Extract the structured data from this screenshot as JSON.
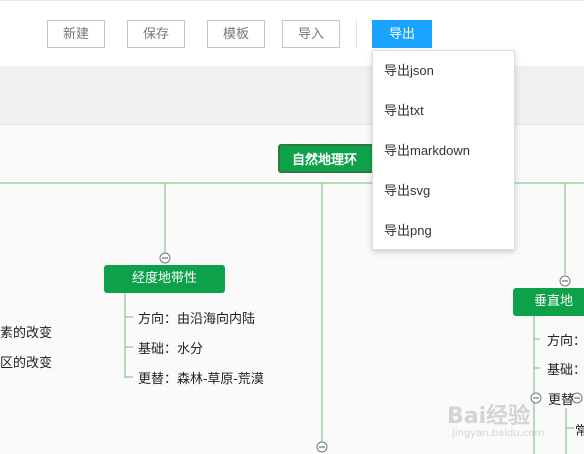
{
  "toolbar": {
    "new": "新建",
    "save": "保存",
    "template": "模板",
    "import": "导入",
    "export": "导出"
  },
  "export_menu": {
    "items": [
      "导出json",
      "导出txt",
      "导出markdown",
      "导出svg",
      "导出png"
    ]
  },
  "mindmap": {
    "root": "自然地理环",
    "left_leaves": [
      "素的改变",
      "区的改变"
    ],
    "branch_longitude": {
      "title": "经度地带性",
      "items": [
        "方向：由沿海向内陆",
        "基础：水分",
        "更替：森林-草原-荒漠"
      ]
    },
    "branch_vertical": {
      "title": "垂直地",
      "items": [
        "方向：",
        "基础：",
        "更替"
      ],
      "sub_items": [
        "常"
      ]
    }
  },
  "watermark": {
    "text": "Bai经验",
    "url": "jingyan.baidu.com"
  },
  "colors": {
    "node_fill": "#0da24a",
    "line": "#6cc07a",
    "accent": "#1aa3ff"
  }
}
